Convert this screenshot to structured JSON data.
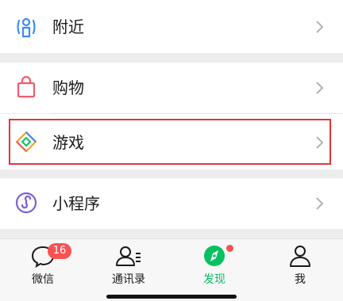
{
  "list": {
    "nearby": {
      "label": "附近",
      "icon": "nearby-person-icon"
    },
    "shopping": {
      "label": "购物",
      "icon": "shopping-bag-icon"
    },
    "games": {
      "label": "游戏",
      "icon": "games-diamond-icon"
    },
    "mini_programs": {
      "label": "小程序",
      "icon": "mini-program-icon"
    }
  },
  "tabbar": {
    "chats": {
      "label": "微信",
      "badge": "16",
      "icon": "chat-bubble-icon"
    },
    "contacts": {
      "label": "通讯录",
      "icon": "contacts-icon"
    },
    "discover": {
      "label": "发现",
      "icon": "discover-compass-icon",
      "active": true
    },
    "me": {
      "label": "我",
      "icon": "person-icon"
    }
  },
  "colors": {
    "accent": "#07c160",
    "badge": "#fa5151",
    "highlight_border": "#e2343a",
    "background": "#ededed"
  }
}
